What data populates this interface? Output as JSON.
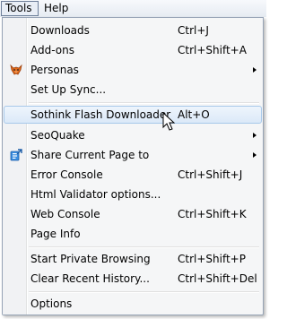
{
  "menubar": {
    "tools": "Tools",
    "help": "Help"
  },
  "menu": {
    "items": [
      {
        "label": "Downloads",
        "shortcut": "Ctrl+J"
      },
      {
        "label": "Add-ons",
        "shortcut": "Ctrl+Shift+A"
      },
      {
        "label": "Personas",
        "shortcut": "",
        "icon": "personas-fox-icon",
        "submenu": true
      },
      {
        "label": "Set Up Sync...",
        "shortcut": ""
      },
      {
        "label": "Sothink Flash Downloader",
        "shortcut": "Alt+O",
        "hovered": true
      },
      {
        "label": "SeoQuake",
        "shortcut": "",
        "submenu": true
      },
      {
        "label": "Share Current Page to",
        "shortcut": "",
        "icon": "share-page-icon",
        "submenu": true
      },
      {
        "label": "Error Console",
        "shortcut": "Ctrl+Shift+J"
      },
      {
        "label": "Html Validator options...",
        "shortcut": ""
      },
      {
        "label": "Web Console",
        "shortcut": "Ctrl+Shift+K"
      },
      {
        "label": "Page Info",
        "shortcut": ""
      },
      {
        "label": "Start Private Browsing",
        "shortcut": "Ctrl+Shift+P"
      },
      {
        "label": "Clear Recent History...",
        "shortcut": "Ctrl+Shift+Del"
      },
      {
        "label": "Options",
        "shortcut": ""
      }
    ]
  },
  "colors": {
    "menu_background": "#f5f6f7",
    "hover_border": "#a8c9ea",
    "hover_fill": "#dbe9f8"
  }
}
